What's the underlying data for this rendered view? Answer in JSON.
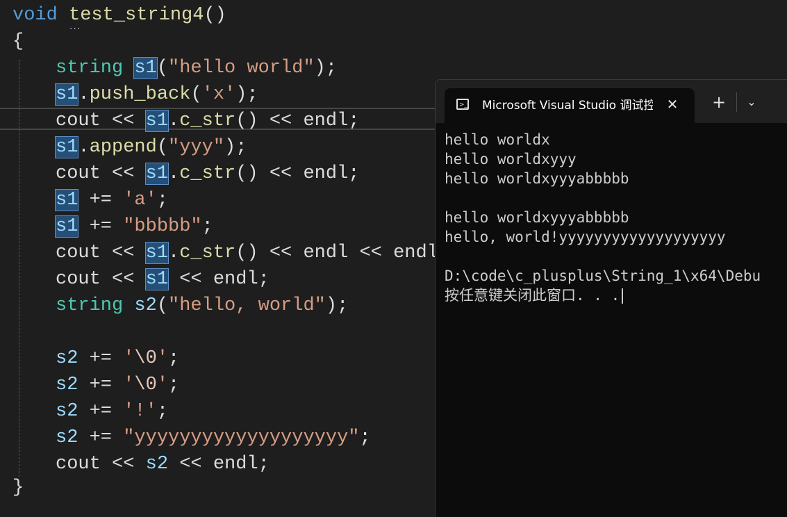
{
  "editor": {
    "function_signature": {
      "keyword": "void",
      "name": "test_string4",
      "parens": "()"
    },
    "open_brace": "{",
    "close_brace": "}",
    "lines": {
      "l1": {
        "type": "string",
        "sp": " ",
        "var": "s1",
        "open": "(",
        "lit": "\"hello world\"",
        "close": ");"
      },
      "l2": {
        "var": "s1",
        "dot": ".",
        "fn": "push_back",
        "open": "(",
        "lit": "'x'",
        "close": ");"
      },
      "l3": {
        "cout": "cout << ",
        "var": "s1",
        "dot": ".",
        "fn": "c_str",
        "rest": "() << endl;"
      },
      "l4": {
        "var": "s1",
        "dot": ".",
        "fn": "append",
        "open": "(",
        "lit": "\"yyy\"",
        "close": ");"
      },
      "l5": {
        "cout": "cout << ",
        "var": "s1",
        "dot": ".",
        "fn": "c_str",
        "rest": "() << endl;"
      },
      "l6": {
        "var": "s1",
        "op": " += ",
        "lit": "'a'",
        "end": ";"
      },
      "l7": {
        "var": "s1",
        "op": " += ",
        "lit": "\"bbbbb\"",
        "end": ";"
      },
      "l8": {
        "cout": "cout << ",
        "var": "s1",
        "dot": ".",
        "fn": "c_str",
        "rest": "() << endl << endl;"
      },
      "l9": {
        "cout": "cout << ",
        "var": "s1",
        "rest": " << endl;"
      },
      "l10": {
        "type": "string",
        "sp": " ",
        "var": "s2",
        "open": "(",
        "lit": "\"hello, world\"",
        "close": ");"
      },
      "l11": {
        "var": "s2",
        "op": " += ",
        "q1": "'",
        "esc": "\\0",
        "q2": "'",
        "end": ";"
      },
      "l12": {
        "var": "s2",
        "op": " += ",
        "q1": "'",
        "esc": "\\0",
        "q2": "'",
        "end": ";"
      },
      "l13": {
        "var": "s2",
        "op": " += ",
        "lit": "'!'",
        "end": ";"
      },
      "l14": {
        "var": "s2",
        "op": " += ",
        "lit": "\"yyyyyyyyyyyyyyyyyyy\"",
        "end": ";"
      },
      "l15": {
        "cout": "cout << ",
        "var": "s2",
        "rest": " << endl;"
      }
    },
    "peek_dots": "..."
  },
  "terminal": {
    "tab_title": "Microsoft Visual Studio 调试控制台",
    "tab_icon": "console-icon",
    "close_glyph": "✕",
    "new_tab_glyph": "+",
    "dropdown_glyph": "⌄",
    "output": [
      "hello worldx",
      "hello worldxyyy",
      "hello worldxyyyabbbbb",
      "",
      "hello worldxyyyabbbbb",
      "hello, world!yyyyyyyyyyyyyyyyyyy",
      "",
      "D:\\code\\c_plusplus\\String_1\\x64\\Debu",
      "按任意键关闭此窗口. . ."
    ]
  },
  "colors": {
    "editor_bg": "#1e1e1e",
    "keyword": "#569cd6",
    "type": "#4ec9b0",
    "function": "#dcdcaa",
    "string": "#d69d85",
    "variable": "#9cdcfe",
    "highlight": "#264f78",
    "terminal_bg": "#0c0c0c"
  }
}
